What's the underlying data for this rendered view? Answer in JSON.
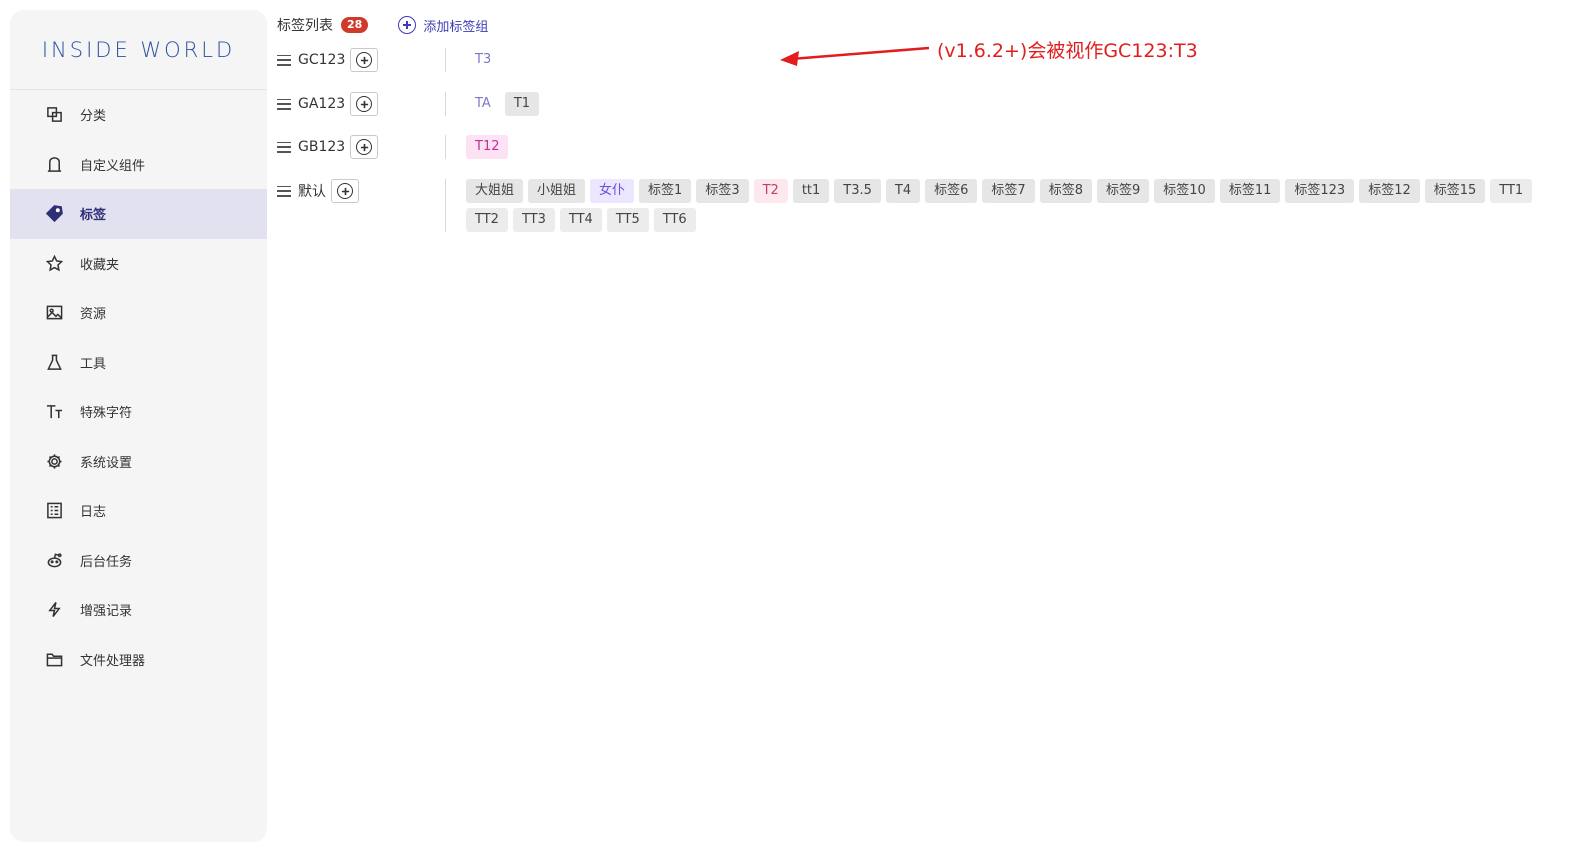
{
  "sidebar": {
    "logo": "INSIDE WORLD",
    "items": [
      {
        "label": "分类",
        "icon": "copy-icon"
      },
      {
        "label": "自定义组件",
        "icon": "component-icon"
      },
      {
        "label": "标签",
        "icon": "tag-icon",
        "active": true
      },
      {
        "label": "收藏夹",
        "icon": "star-icon"
      },
      {
        "label": "资源",
        "icon": "image-icon"
      },
      {
        "label": "工具",
        "icon": "flask-icon"
      },
      {
        "label": "特殊字符",
        "icon": "text-icon"
      },
      {
        "label": "系统设置",
        "icon": "gear-icon"
      },
      {
        "label": "日志",
        "icon": "log-icon"
      },
      {
        "label": "后台任务",
        "icon": "reddit-icon"
      },
      {
        "label": "增强记录",
        "icon": "bolt-icon"
      },
      {
        "label": "文件处理器",
        "icon": "folder-icon"
      }
    ]
  },
  "header": {
    "title": "标签列表",
    "count": "28",
    "add_group": "添加标签组"
  },
  "groups": [
    {
      "name": "GC123",
      "tags": [
        {
          "label": "T3",
          "style": "plain"
        }
      ]
    },
    {
      "name": "GA123",
      "tags": [
        {
          "label": "TA",
          "style": "plain"
        },
        {
          "label": "T1",
          "style": "default"
        }
      ]
    },
    {
      "name": "GB123",
      "tags": [
        {
          "label": "T12",
          "style": "pink"
        }
      ]
    },
    {
      "name": "默认",
      "tags": [
        {
          "label": "大姐姐",
          "style": "default"
        },
        {
          "label": "小姐姐",
          "style": "default"
        },
        {
          "label": "女仆",
          "style": "lilac"
        },
        {
          "label": "标签1",
          "style": "default"
        },
        {
          "label": "标签3",
          "style": "default"
        },
        {
          "label": "T2",
          "style": "rose"
        },
        {
          "label": "tt1",
          "style": "default"
        },
        {
          "label": "T3.5",
          "style": "default"
        },
        {
          "label": "T4",
          "style": "default"
        },
        {
          "label": "标签6",
          "style": "default"
        },
        {
          "label": "标签7",
          "style": "default"
        },
        {
          "label": "标签8",
          "style": "default"
        },
        {
          "label": "标签9",
          "style": "default"
        },
        {
          "label": "标签10",
          "style": "default"
        },
        {
          "label": "标签11",
          "style": "default"
        },
        {
          "label": "标签123",
          "style": "default"
        },
        {
          "label": "标签12",
          "style": "default"
        },
        {
          "label": "标签15",
          "style": "default"
        },
        {
          "label": "TT1",
          "style": "light"
        },
        {
          "label": "TT2",
          "style": "light"
        },
        {
          "label": "TT3",
          "style": "light"
        },
        {
          "label": "TT4",
          "style": "light"
        },
        {
          "label": "TT5",
          "style": "light"
        },
        {
          "label": "TT6",
          "style": "light"
        }
      ]
    }
  ],
  "annotation": {
    "text": "(v1.6.2+)会被视作GC123:T3",
    "color": "#e11d1d"
  }
}
